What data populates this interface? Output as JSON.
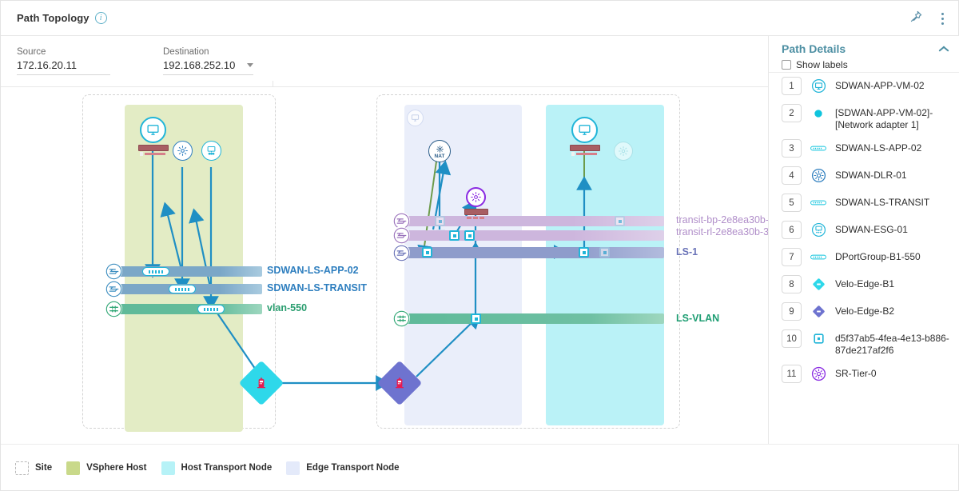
{
  "header": {
    "title": "Path Topology",
    "info_icon": "info-icon",
    "pin_icon": "pin-icon",
    "overflow_icon": "kebab-menu-icon"
  },
  "toolbar": {
    "source": {
      "label": "Source",
      "value": "172.16.20.11"
    },
    "destination": {
      "label": "Destination",
      "value": "192.168.252.10",
      "caret": "chevron-down-icon"
    },
    "swap": {
      "back_icon": "arrow-left-icon",
      "forward_icon": "arrow-right-icon"
    }
  },
  "legend": {
    "items": [
      {
        "label": "Site",
        "color": "#ffffff",
        "style": "dashed"
      },
      {
        "label": "VSphere Host",
        "color": "#c9d98a"
      },
      {
        "label": "Host Transport Node",
        "color": "#b6f2f7"
      },
      {
        "label": "Edge Transport Node",
        "color": "#e4eafa"
      }
    ]
  },
  "panel": {
    "title": "Path Details",
    "collapse_icon": "chevron-up-icon",
    "show_labels": {
      "label": "Show labels",
      "checked": false
    },
    "items": [
      {
        "num": "1",
        "label": "SDWAN-APP-VM-02",
        "icon": "vm-icon"
      },
      {
        "num": "2",
        "label": "[SDWAN-APP-VM-02]-[Network adapter 1]",
        "icon": "network-adapter-icon"
      },
      {
        "num": "3",
        "label": "SDWAN-LS-APP-02",
        "icon": "logical-switch-icon"
      },
      {
        "num": "4",
        "label": "SDWAN-DLR-01",
        "icon": "router-icon"
      },
      {
        "num": "5",
        "label": "SDWAN-LS-TRANSIT",
        "icon": "logical-switch-icon"
      },
      {
        "num": "6",
        "label": "SDWAN-ESG-01",
        "icon": "edge-gateway-icon"
      },
      {
        "num": "7",
        "label": "DPortGroup-B1-550",
        "icon": "logical-switch-icon"
      },
      {
        "num": "8",
        "label": "Velo-Edge-B1",
        "icon": "velo-edge-cyan-icon"
      },
      {
        "num": "9",
        "label": "Velo-Edge-B2",
        "icon": "velo-edge-purple-icon"
      },
      {
        "num": "10",
        "label": "d5f37ab5-4fea-4e13-b886-87de217af2f6",
        "icon": "port-icon"
      },
      {
        "num": "11",
        "label": "SR-Tier-0",
        "icon": "service-router-icon"
      }
    ]
  },
  "canvas": {
    "segments": [
      {
        "name": "SDWAN-LS-APP-02",
        "label": "SDWAN-LS-APP-02",
        "color": "#7ba7c7",
        "text_color": "#2f7fbf"
      },
      {
        "name": "SDWAN-LS-TRANSIT",
        "label": "SDWAN-LS-TRANSIT",
        "color": "#7ba7c7",
        "text_color": "#2f7fbf"
      },
      {
        "name": "vlan-550",
        "label": "vlan-550",
        "color": "#57b894",
        "text_color": "#2a9d6f"
      },
      {
        "name": "transit-bp",
        "label": "transit-bp-2e8ea30b-",
        "color": "#cdb6dd",
        "text_color": "#b08ec9"
      },
      {
        "name": "transit-rl",
        "label": "transit-rl-2e8ea30b-3",
        "color": "#cdb6dd",
        "text_color": "#b08ec9"
      },
      {
        "name": "LS-1",
        "label": "LS-1",
        "color": "#8e9ccb",
        "text_color": "#6a73b8"
      },
      {
        "name": "LS-VLAN",
        "label": "LS-VLAN",
        "color": "#57b894",
        "text_color": "#1f9e73"
      }
    ],
    "nodes": [
      {
        "name": "vm-node-left",
        "icon": "vm-icon"
      },
      {
        "name": "dlr-node",
        "icon": "router-icon"
      },
      {
        "name": "esg-node",
        "icon": "edge-gateway-icon"
      },
      {
        "name": "nat-node",
        "icon": "nat-router-icon",
        "text": "NAT"
      },
      {
        "name": "sr-tier0-node",
        "icon": "service-router-icon"
      },
      {
        "name": "vm-node-right",
        "icon": "vm-icon"
      },
      {
        "name": "ghost-router-node",
        "icon": "router-icon"
      },
      {
        "name": "ghost-vm-node",
        "icon": "vm-icon"
      },
      {
        "name": "velo-edge-b1",
        "icon": "velo-edge-cyan-icon"
      },
      {
        "name": "velo-edge-b2",
        "icon": "velo-edge-purple-icon"
      }
    ]
  }
}
